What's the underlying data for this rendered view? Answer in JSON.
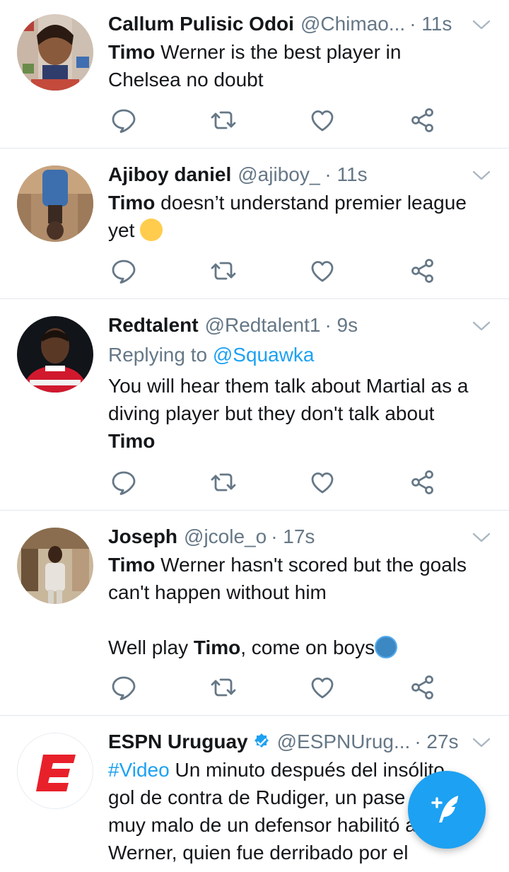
{
  "tweets": [
    {
      "name": "Callum Pulisic Odoi",
      "handle": "@Chimao...",
      "time": "· 11s",
      "line1_bold": "Timo",
      "line1_rest": " Werner is the best player in",
      "line2": "Chelsea no doubt"
    },
    {
      "name": "Ajiboy daniel",
      "handle": "@ajiboy_",
      "time": "· 11s",
      "line1_bold": "Timo",
      "line1_rest": " doesn’t understand premier league",
      "line2": "yet"
    },
    {
      "name": "Redtalent",
      "handle": "@Redtalent1",
      "time": "· 9s",
      "replying_prefix": "Replying to ",
      "replying_to": "@Squawka",
      "line1": "You will hear them talk about Martial as a",
      "line2": "diving player but they don't talk about",
      "line3_bold": "Timo"
    },
    {
      "name": "Joseph",
      "handle": "@jcole_o",
      "time": "· 17s",
      "line1_bold": "Timo",
      "line1_rest": " Werner hasn't scored but the goals",
      "line2": "can't happen without him",
      "line3_pre": "Well play ",
      "line3_bold": "Timo",
      "line3_post": ", come on boys"
    },
    {
      "name": "ESPN Uruguay",
      "handle": "@ESPNUrug...",
      "time": "· 27s",
      "hashtag": "#Video",
      "line1_rest": " Un minuto después del insólito",
      "line2": "gol de contra de Rudiger, un pase",
      "line3": "muy malo de un defensor habilitó a Timo",
      "line4": "Werner, quien fue derribado por el"
    }
  ],
  "icons": {
    "reply": "reply-icon",
    "retweet": "retweet-icon",
    "like": "heart-icon",
    "share": "share-icon",
    "compose": "compose-tweet-icon",
    "caret": "chevron-down-icon",
    "verified": "verified-badge-icon"
  },
  "colors": {
    "accent": "#1da1f2",
    "secondary_text": "#657786",
    "primary_text": "#14171a",
    "divider": "#e1e8ed"
  }
}
